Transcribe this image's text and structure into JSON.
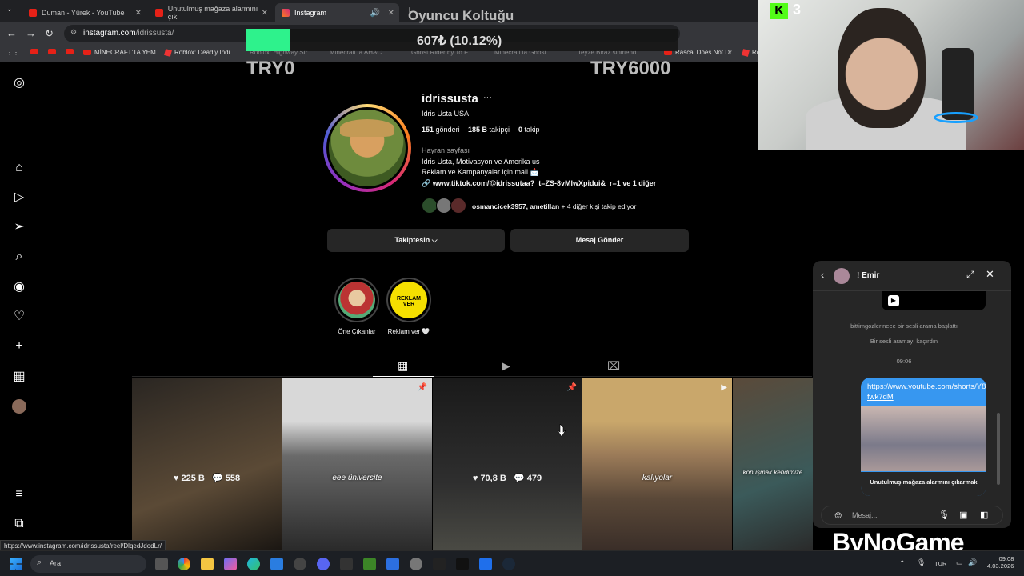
{
  "browser": {
    "tabs": [
      {
        "title": "Duman - Yürek - YouTube",
        "color": "#e62117"
      },
      {
        "title": "Unutulmuş mağaza alarmını çık",
        "color": "#e62117"
      },
      {
        "title": "Instagram",
        "color": "#d62976"
      }
    ],
    "new_tab": "+",
    "url_host": "instagram.com",
    "url_path": "/idrissusta/",
    "bookmarks": [
      "MİNECRAFT'TA YEM...",
      "Roblox: Deadly Indi...",
      "Roblox: Highway Str...",
      "Minecraft'ta AHAC...",
      "Ghost Rider by To F...",
      "Minecraft'ta Ghost...",
      "Teyze Biraz sinirlend...",
      "Rascal Does Not Dr...",
      "Ro"
    ]
  },
  "overlay": {
    "goal_title": "Oyuncu Koltuğu",
    "goal_amount": "607₺ (10.12%)",
    "goal_progress": 0.1012,
    "goal_min": "TRY0",
    "goal_max": "TRY6000",
    "kick_count": "3",
    "kick_badge": "K",
    "watermark": "ByNoGame"
  },
  "profile": {
    "username": "idrissusta",
    "more": "···",
    "full_name": "İdris Usta USA",
    "stats": [
      {
        "num": "151",
        "label": "gönderi"
      },
      {
        "num": "185 B",
        "label": "takipçi"
      },
      {
        "num": "0",
        "label": "takip"
      }
    ],
    "category": "Hayran sayfası",
    "bio_line1": "İdris Usta, Motivasyon ve Amerika us",
    "bio_line2": "Reklam ve Kampanyalar için mail 📩",
    "link": "www.tiktok.com/@idrissutaa?_t=ZS-8vMlwXpidui&_r=1 ve 1 diğer",
    "followed_by_names": "osmancicek3957, ametillan",
    "followed_by_rest": " + 4 diğer kişi takip ediyor",
    "follow_button": "Takiptesin ⌵",
    "message_button": "Mesaj Gönder",
    "highlights": [
      {
        "label": "Öne Çıkanlar"
      },
      {
        "label": "Reklam ver 🤍",
        "inner": "REKLAM VER"
      }
    ],
    "posts": [
      {
        "likes": "225 B",
        "comments": "558",
        "caption": ""
      },
      {
        "likes": "",
        "comments": "",
        "caption": "eee üniversite"
      },
      {
        "likes": "70,8 B",
        "comments": "479",
        "caption": ""
      },
      {
        "likes": "",
        "comments": "",
        "caption": "kalıyolar"
      },
      {
        "likes": "",
        "comments": "",
        "caption": "konuşmak kendimize"
      }
    ]
  },
  "dm": {
    "name": "! Emir",
    "sys1": "bittimgozlerineee bir sesli arama başlattı",
    "sys2": "Bir sesli aramayı kaçırdın",
    "time": "09:06",
    "link": "https://www.youtube.com/shorts/Y809-fwk7dM",
    "thumb_caption": "Unutulmuş mağaza alarmını çıkarmak",
    "placeholder": "Mesaj..."
  },
  "status_url": "https://www.instagram.com/idrissusta/reel/DlqedJdodLr/",
  "taskbar": {
    "search": "Ara",
    "lang": "TUR",
    "time": "09:08",
    "date": "4.03.2026"
  }
}
